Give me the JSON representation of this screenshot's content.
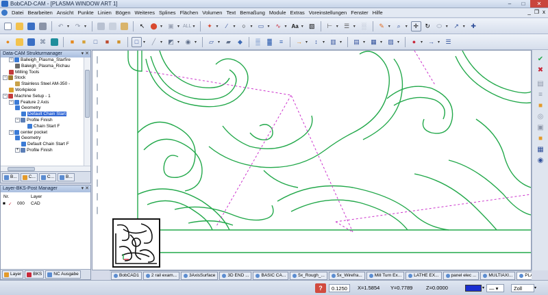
{
  "window": {
    "title": "BobCAD-CAM - [PLASMA WINDOW ART 1]",
    "minimize": "–",
    "maximize": "□",
    "close": "✕"
  },
  "menu": {
    "items": [
      "Datei",
      "Bearbeiten",
      "Ansicht",
      "Punkte",
      "Linien",
      "Bögen",
      "Weiteres",
      "Splines",
      "Flächen",
      "Volumen",
      "Text",
      "Bemaßung",
      "Module",
      "Extras",
      "Voreinstellungen",
      "Fenster",
      "Hilfe"
    ],
    "mdi_controls": [
      "_",
      " &#x25A1;",
      "x"
    ]
  },
  "toolbar1": {
    "all_label": "ALL",
    "text_tool_label": "Aa"
  },
  "tree_panel": {
    "title": "Data-CAM Strukturmanager",
    "header_buttons": "▾ ✕",
    "items": [
      {
        "label": "Balleigh_Plasma_Starfire",
        "indent": 1,
        "toggle": "−",
        "icon_color": "#3b7bd6"
      },
      {
        "label": "Baleigh_Plasma_Richau",
        "indent": 2,
        "toggle": "",
        "icon_color": "#6b6b6b"
      },
      {
        "label": "Milling Tools",
        "indent": 1,
        "toggle": "",
        "icon_color": "#c33b3b"
      },
      {
        "label": "Stock",
        "indent": 0,
        "toggle": "−",
        "icon_color": "#a07a30"
      },
      {
        "label": "Stainless Steel AM-350 -",
        "indent": 2,
        "toggle": "",
        "icon_color": "#c9a24a"
      },
      {
        "label": "Workpiece",
        "indent": 1,
        "toggle": "",
        "icon_color": "#d9a02a"
      },
      {
        "label": "Machine Setup - 1",
        "indent": 0,
        "toggle": "−",
        "icon_color": "#c43a3a"
      },
      {
        "label": "Feature 2 Axis",
        "indent": 1,
        "toggle": "−",
        "icon_color": "#3b7bd6"
      },
      {
        "label": "Geometry",
        "indent": 2,
        "toggle": "",
        "icon_color": "#3b7bd6"
      },
      {
        "label": "Default Chain Start",
        "indent": 3,
        "toggle": "",
        "icon_color": "#3b7bd6",
        "selected": true
      },
      {
        "label": "Profile Finish",
        "indent": 2,
        "toggle": "−",
        "icon_color": "#5c7fb7"
      },
      {
        "label": "Chain Start F",
        "indent": 4,
        "toggle": "",
        "icon_color": "#3b7bd6"
      },
      {
        "label": "center pocket",
        "indent": 1,
        "toggle": "−",
        "icon_color": "#3b7bd6"
      },
      {
        "label": "Geometry",
        "indent": 2,
        "toggle": "",
        "icon_color": "#3b7bd6"
      },
      {
        "label": "Default Chain Start F",
        "indent": 3,
        "toggle": "",
        "icon_color": "#3b7bd6"
      },
      {
        "label": "Profile Finish",
        "indent": 2,
        "toggle": "+",
        "icon_color": "#5c7fb7"
      }
    ],
    "tabs": [
      "B...",
      "C...",
      "C...",
      "B..."
    ]
  },
  "layer_panel": {
    "title": "Layer-BKS-Post Manager",
    "header_buttons": "▾ ✕",
    "col_nr": "Nr.",
    "col_layer": "Layer",
    "row": {
      "nr": "000",
      "name": "CAD"
    },
    "tabs": [
      "Layer",
      "BKS",
      "NC Ausgabe"
    ]
  },
  "doc_tabs": [
    "BobCAD1",
    "2 rail exam...",
    "3AxisSurface",
    "3D END ...",
    "BASIC CA...",
    "5x_Rough_...",
    "5x_Wirefra...",
    "Mill Turn Ex...",
    "LATHE EX...",
    "panel elec ...",
    "MULTIAXI...",
    "PLASMA ..."
  ],
  "status": {
    "help": "?",
    "step": "0.1250",
    "x": "X=1.5854",
    "y": "Y=0.7789",
    "z": "Z=0.0000",
    "zoom": "Zoll",
    "pen_color": "#1a2fd0"
  },
  "colors": {
    "geometry": "#22a84a",
    "toolpath": "#cc33cc",
    "selection": "#3369d6"
  }
}
